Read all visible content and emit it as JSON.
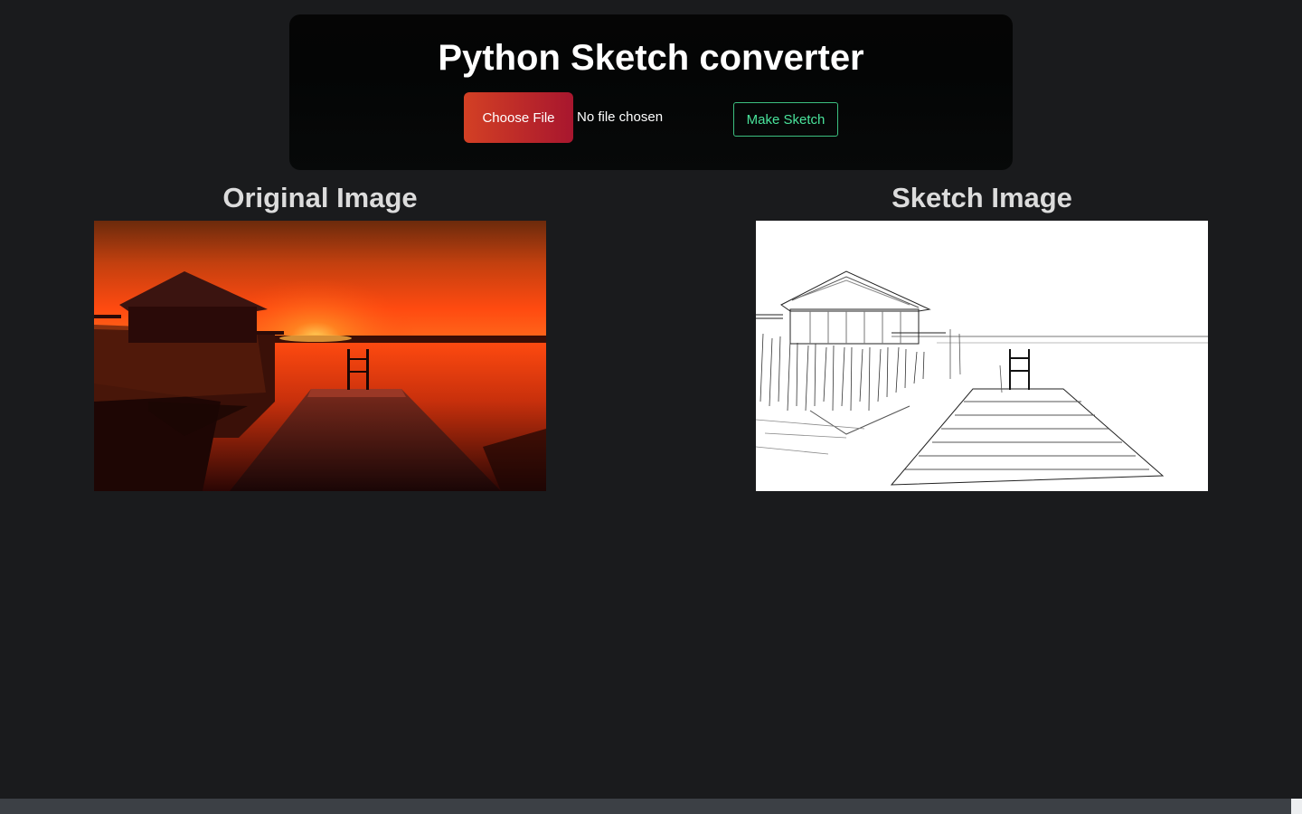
{
  "header": {
    "title": "Python Sketch converter",
    "choose_file_label": "Choose File",
    "file_status": "No file chosen",
    "make_sketch_label": "Make Sketch"
  },
  "panels": {
    "original": {
      "heading": "Original Image"
    },
    "sketch": {
      "heading": "Sketch Image"
    }
  },
  "colors": {
    "page_background": "#1a1b1d",
    "header_background": "#050505",
    "accent_green": "#49e39b",
    "choose_file_gradient_start": "#d34024",
    "choose_file_gradient_end": "#a8162e"
  }
}
